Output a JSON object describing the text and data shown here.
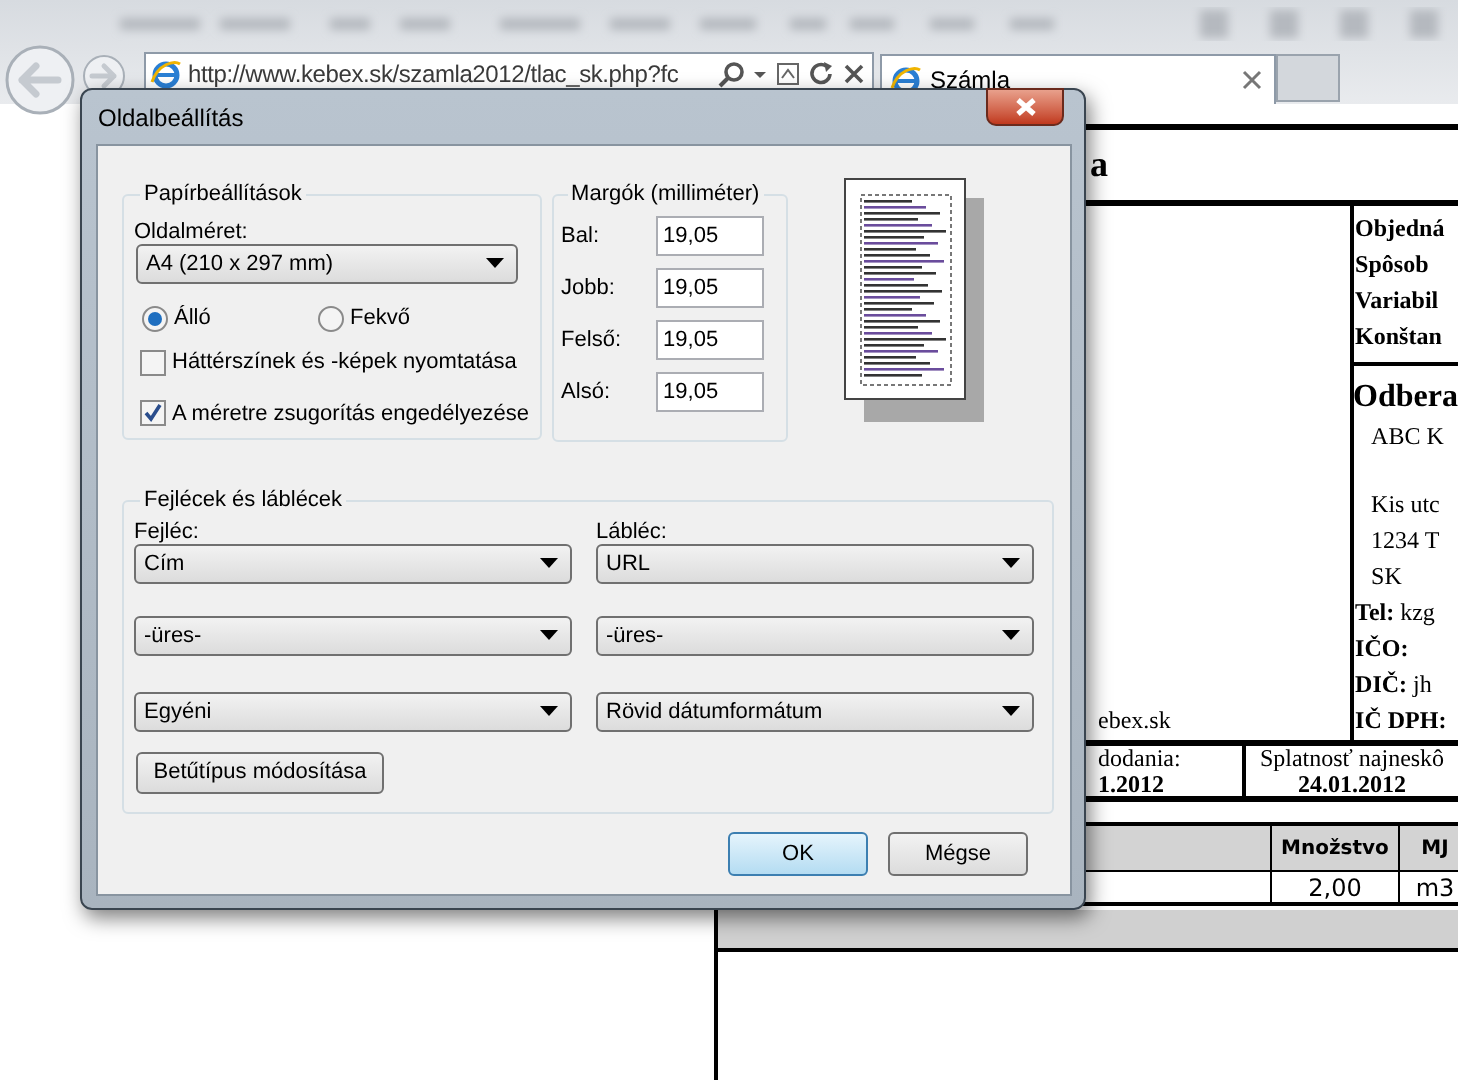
{
  "browser": {
    "address": "http://www.kebex.sk/szamla2012/tlac_sk.php?fc",
    "tabs": [
      {
        "label": "Számla",
        "selected": true
      }
    ]
  },
  "invoice": {
    "title_fragment": "a",
    "side": [
      {
        "text": "Objedná",
        "kind": "bold"
      },
      {
        "text": "Spôsob",
        "kind": "bold"
      },
      {
        "text": "Variabil",
        "kind": "bold"
      },
      {
        "text": "Konštan",
        "kind": "bold"
      },
      {
        "text": "Odbera",
        "kind": "heading"
      },
      {
        "text": "ABC K",
        "kind": "plain"
      },
      {
        "text": "Kis utc",
        "kind": "plain",
        "gap_before": true
      },
      {
        "text": "1234 T",
        "kind": "plain"
      },
      {
        "text": "SK",
        "kind": "plain"
      },
      {
        "text": "**Tel:** kzg",
        "kind": "rich"
      },
      {
        "text": "IČO:",
        "kind": "bold"
      },
      {
        "text": "**DIČ:** jh",
        "kind": "rich"
      },
      {
        "text": "IČ DPH:",
        "kind": "bold"
      }
    ],
    "left_fragment": "ebex.sk",
    "dates": [
      {
        "label": "dodania:",
        "value": "1.2012"
      },
      {
        "label": "Splatnosť najneskô",
        "value": "24.01.2012"
      }
    ],
    "table": {
      "columns": [
        "Množstvo",
        "MJ"
      ],
      "rows": [
        [
          "2,00",
          "m3"
        ]
      ]
    }
  },
  "dialog": {
    "title": "Oldalbeállítás",
    "paper": {
      "legend": "Papírbeállítások",
      "size_label": "Oldalméret:",
      "size": "A4 (210 x 297 mm)",
      "orientation": [
        {
          "label": "Álló",
          "selected": true
        },
        {
          "label": "Fekvő",
          "selected": false
        }
      ],
      "options": [
        {
          "label": "Háttérszínek és -képek nyomtatása",
          "checked": false
        },
        {
          "label": "A méretre zsugorítás engedélyezése",
          "checked": true
        }
      ]
    },
    "margins": {
      "legend": "Margók (milliméter)",
      "fields": [
        {
          "label": "Bal:",
          "value": "19,05"
        },
        {
          "label": "Jobb:",
          "value": "19,05"
        },
        {
          "label": "Felső:",
          "value": "19,05"
        },
        {
          "label": "Alsó:",
          "value": "19,05"
        }
      ]
    },
    "headers_footers": {
      "legend": "Fejlécek és láblécek",
      "header_label": "Fejléc:",
      "footer_label": "Lábléc:",
      "header": [
        "Cím",
        "-üres-",
        "Egyéni"
      ],
      "footer": [
        "URL",
        "-üres-",
        "Rövid dátumformátum"
      ]
    },
    "font_button": "Betűtípus módosítása",
    "buttons": [
      {
        "label": "OK",
        "default": true
      },
      {
        "label": "Mégse",
        "default": false
      }
    ]
  }
}
